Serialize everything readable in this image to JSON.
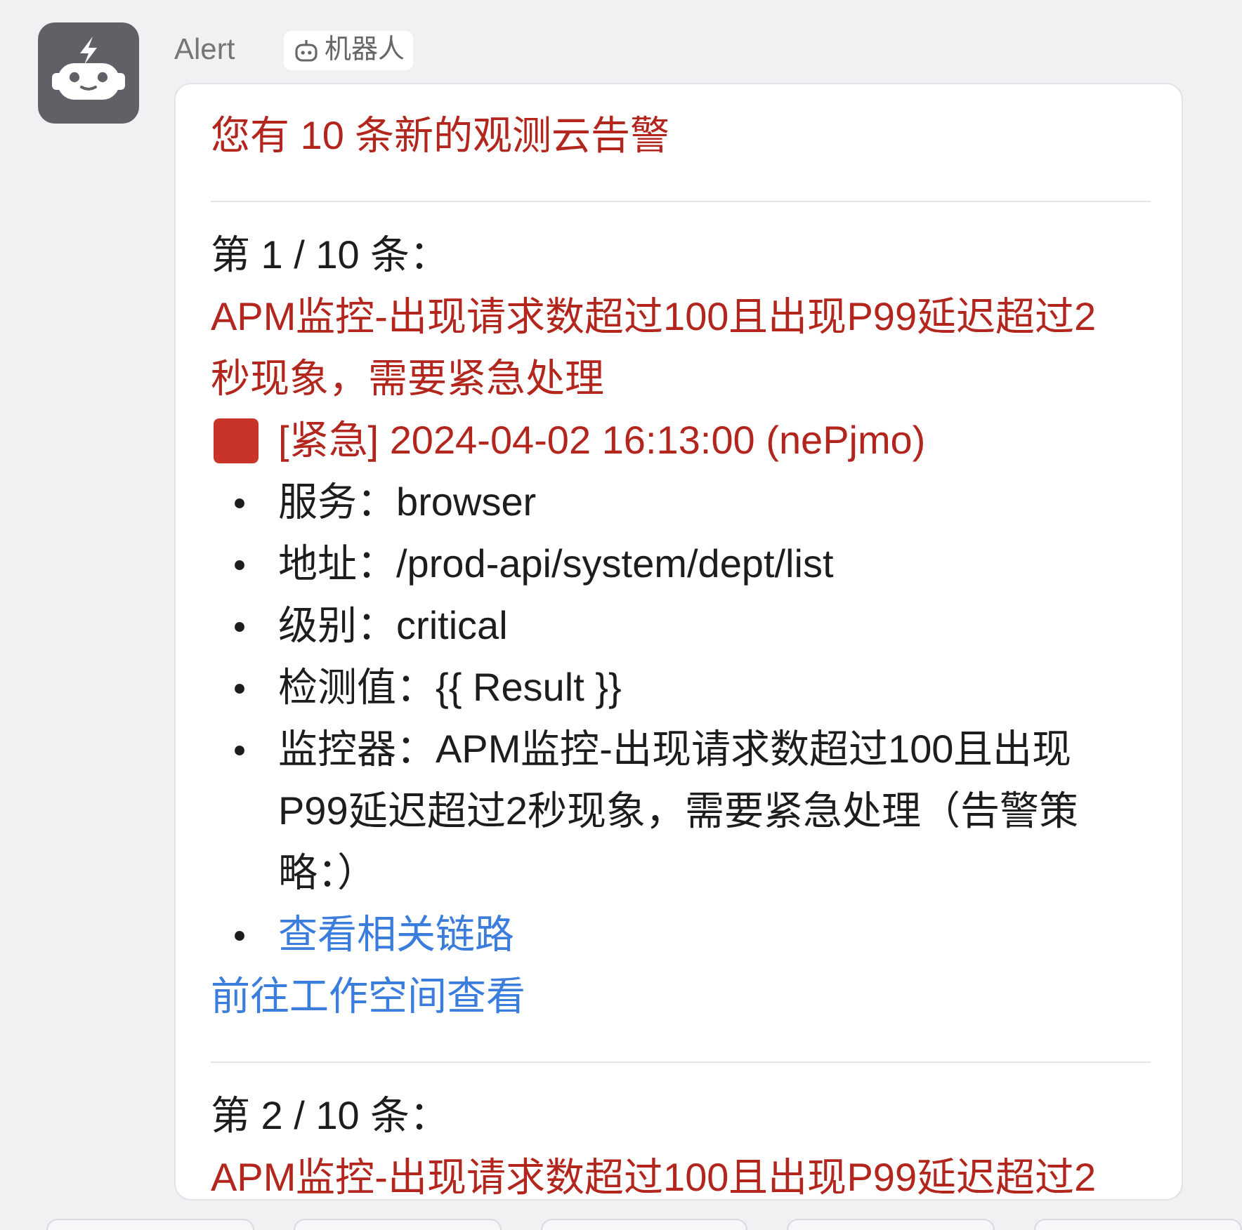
{
  "sender": {
    "name": "Alert",
    "tag": "机器人"
  },
  "message": {
    "title": "您有 10 条新的观测云告警",
    "alerts": [
      {
        "counter": "第 1 / 10 条：",
        "headline": "APM监控-出现请求数超过100且出现P99延迟超过2秒现象，需要紧急处理",
        "status": "[紧急] 2024-04-02 16:13:00 (nePjmo)",
        "details": [
          {
            "kind": "text",
            "text": "服务：browser"
          },
          {
            "kind": "text",
            "text": "地址：/prod-api/system/dept/list"
          },
          {
            "kind": "text",
            "text": "级别：critical"
          },
          {
            "kind": "text",
            "text": "检测值：{{ Result }}"
          },
          {
            "kind": "text",
            "text": "监控器：APM监控-出现请求数超过100且出现P99延迟超过2秒现象，需要紧急处理（告警策略：）"
          },
          {
            "kind": "link",
            "text": "查看相关链路"
          }
        ],
        "workspace_link": "前往工作空间查看"
      },
      {
        "counter": "第 2 / 10 条：",
        "headline": "APM监控-出现请求数超过100且出现P99延迟超过2"
      }
    ]
  }
}
